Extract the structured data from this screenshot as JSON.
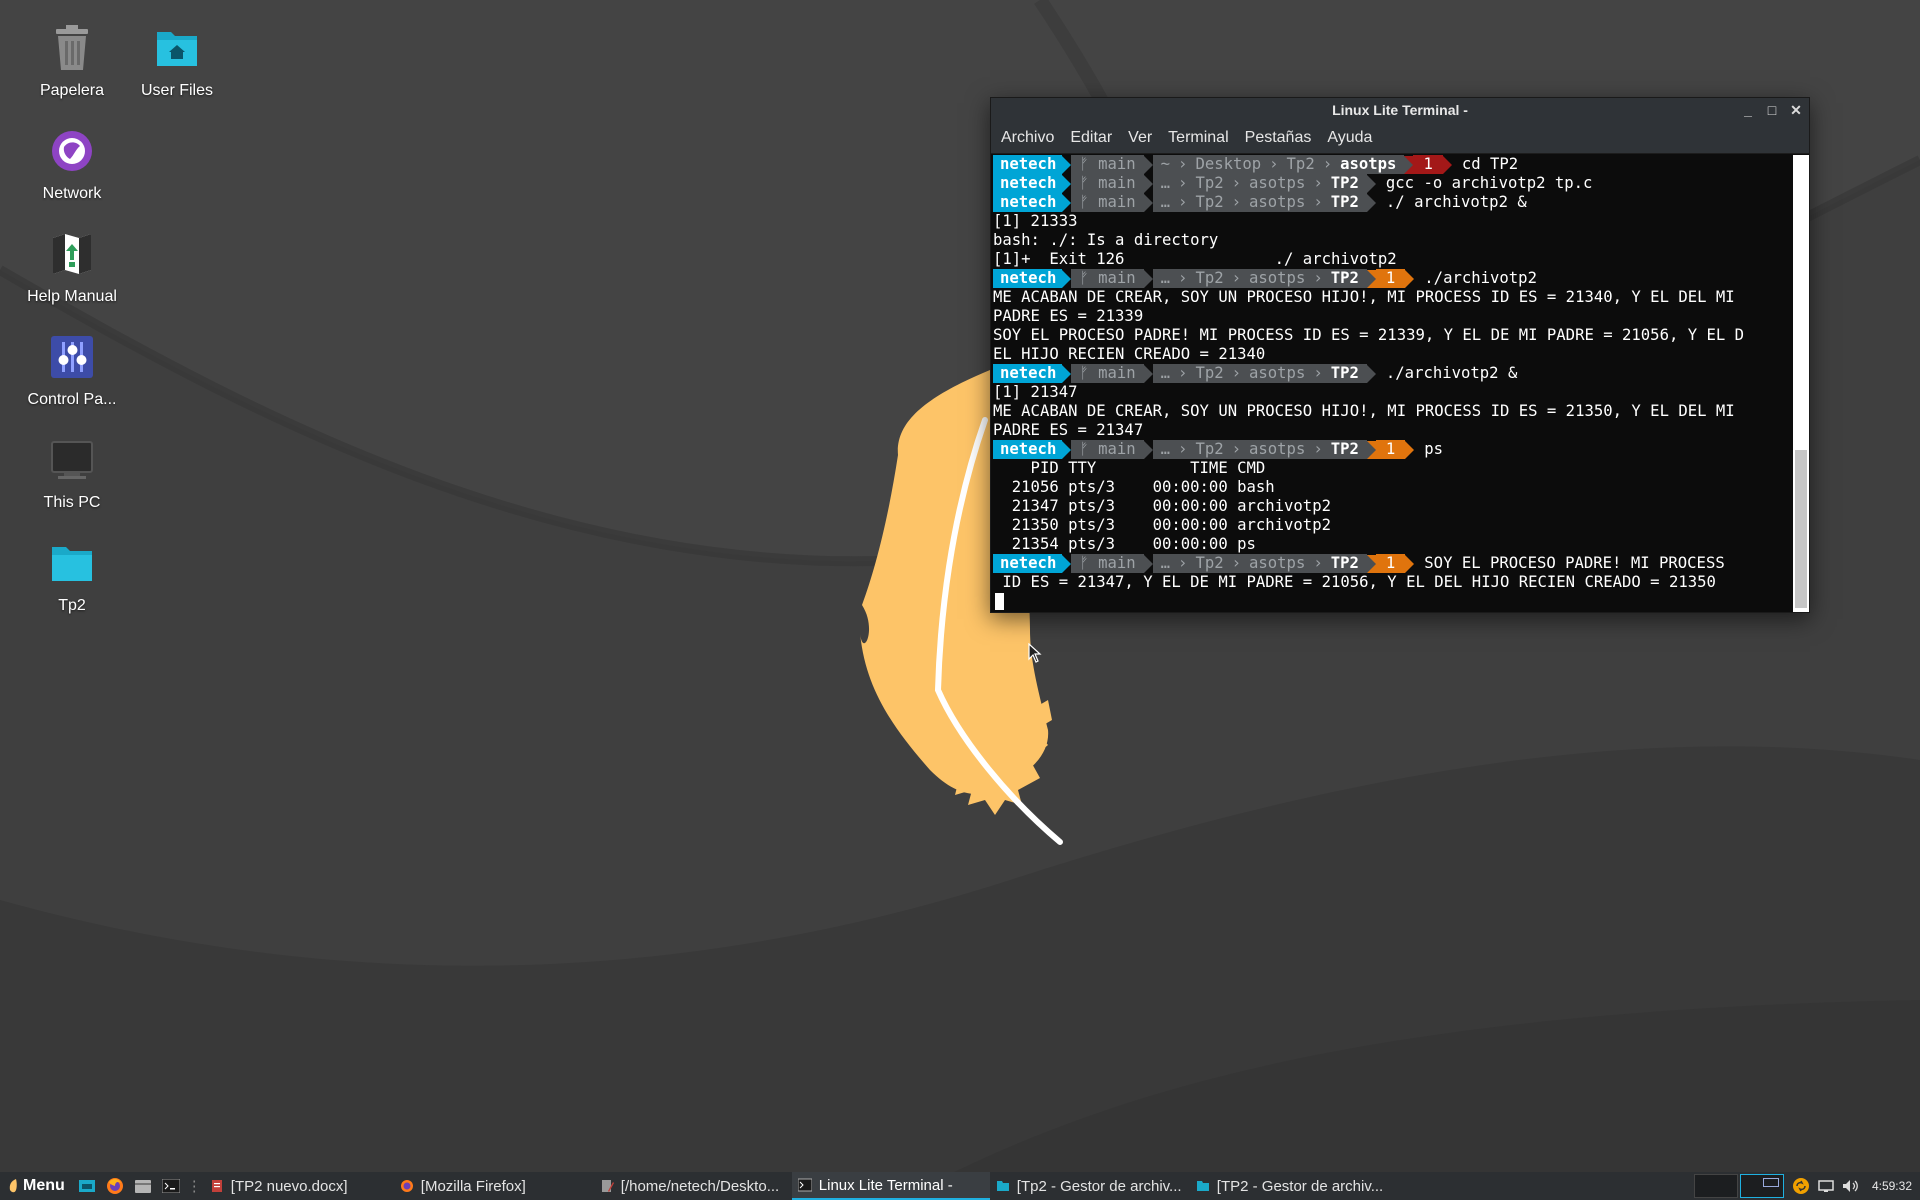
{
  "desktop": {
    "icons": [
      {
        "label": "Papelera",
        "icon": "trash-icon"
      },
      {
        "label": "User Files",
        "icon": "home-folder-icon"
      },
      {
        "label": "Network",
        "icon": "network-globe-icon"
      },
      {
        "label": "Help Manual",
        "icon": "help-manual-icon"
      },
      {
        "label": "Control Pa...",
        "icon": "control-panel-icon"
      },
      {
        "label": "This PC",
        "icon": "computer-icon"
      },
      {
        "label": "Tp2",
        "icon": "folder-icon"
      }
    ]
  },
  "terminal": {
    "title": "Linux Lite Terminal -",
    "controls": {
      "minimize": "_",
      "maximize": "□",
      "close": "✕"
    },
    "menu": [
      "Archivo",
      "Editar",
      "Ver",
      "Terminal",
      "Pestañas",
      "Ayuda"
    ],
    "prompt": {
      "user": "netech",
      "branch": "ᚠ main",
      "home": "~",
      "ellipsis": "…",
      "desktop": "Desktop",
      "tp2": "Tp2",
      "asotps": "asotps",
      "TP2": "TP2",
      "code": "1"
    },
    "lines": {
      "cmd1": "cd TP2",
      "cmd2": "gcc -o archivotp2 tp.c",
      "cmd3": "./ archivotp2 &",
      "out1": "[1] 21333",
      "out2": "bash: ./: Is a directory",
      "out3": "[1]+  Exit 126                ./ archivotp2",
      "cmd4": "./archivotp2",
      "out4": "ME ACABAN DE CREAR, SOY UN PROCESO HIJO!, MI PROCESS ID ES = 21340, Y EL DEL MI",
      "out5": "PADRE ES = 21339",
      "out6": "SOY EL PROCESO PADRE! MI PROCESS ID ES = 21339, Y EL DE MI PADRE = 21056, Y EL D",
      "out7": "EL HIJO RECIEN CREADO = 21340",
      "cmd5": "./archivotp2 &",
      "out8": "[1] 21347",
      "out9": "ME ACABAN DE CREAR, SOY UN PROCESO HIJO!, MI PROCESS ID ES = 21350, Y EL DEL MI",
      "out10": "PADRE ES = 21347",
      "cmd6": "ps",
      "ps_header": "    PID TTY          TIME CMD",
      "ps1": "  21056 pts/3    00:00:00 bash",
      "ps2": "  21347 pts/3    00:00:00 archivotp2",
      "ps3": "  21350 pts/3    00:00:00 archivotp2",
      "ps4": "  21354 pts/3    00:00:00 ps",
      "out11": "SOY EL PROCESO PADRE! MI PROCESS",
      "out12": " ID ES = 21347, Y EL DE MI PADRE = 21056, Y EL DEL HIJO RECIEN CREADO = 21350"
    }
  },
  "taskbar": {
    "menu_label": "Menu",
    "tasks": [
      {
        "label": "[TP2 nuevo.docx]",
        "icon": "document-icon"
      },
      {
        "label": "[Mozilla Firefox]",
        "icon": "firefox-icon"
      },
      {
        "label": "[/home/netech/Deskto...",
        "icon": "editor-icon"
      },
      {
        "label": "Linux Lite Terminal -",
        "icon": "terminal-icon"
      },
      {
        "label": "[Tp2 - Gestor de archiv...",
        "icon": "file-manager-icon"
      },
      {
        "label": "[TP2 - Gestor de archiv...",
        "icon": "file-manager-icon"
      }
    ],
    "clock": "4:59:32"
  },
  "colors": {
    "prompt_user_bg": "#00a5d6",
    "prompt_segment_bg": "#4c4f52",
    "prompt_error_red": "#a31818",
    "prompt_error_orange": "#e0740d",
    "feather": "#fdc468"
  }
}
